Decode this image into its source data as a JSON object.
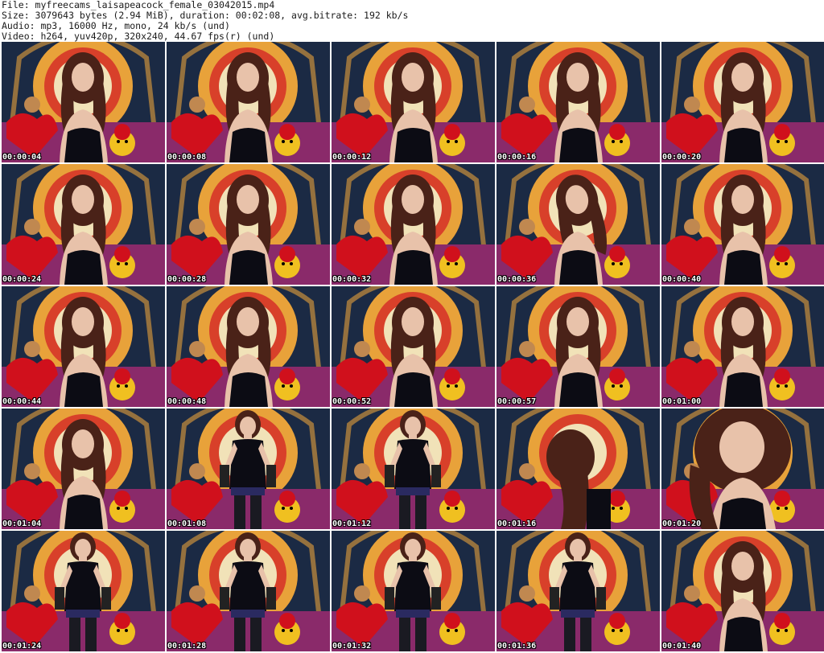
{
  "header": {
    "file": "File: myfreecams_laisapeacock_female_03042015.mp4",
    "size": "Size: 3079643 bytes (2.94 MiB), duration: 00:02:08, avg.bitrate: 192 kb/s",
    "audio": "Audio: mp3, 16000 Hz, mono, 24 kb/s (und)",
    "video": "Video: h264, yuv420p, 320x240, 44.67 fps(r) (und)"
  },
  "thumbnails": [
    {
      "time": "00:00:04",
      "pose": "seated"
    },
    {
      "time": "00:00:08",
      "pose": "seated"
    },
    {
      "time": "00:00:12",
      "pose": "seated"
    },
    {
      "time": "00:00:16",
      "pose": "seated"
    },
    {
      "time": "00:00:20",
      "pose": "seated"
    },
    {
      "time": "00:00:24",
      "pose": "seated"
    },
    {
      "time": "00:00:28",
      "pose": "seated"
    },
    {
      "time": "00:00:32",
      "pose": "seated"
    },
    {
      "time": "00:00:36",
      "pose": "tilted"
    },
    {
      "time": "00:00:40",
      "pose": "seated"
    },
    {
      "time": "00:00:44",
      "pose": "seated"
    },
    {
      "time": "00:00:48",
      "pose": "seated"
    },
    {
      "time": "00:00:52",
      "pose": "seated"
    },
    {
      "time": "00:00:57",
      "pose": "seated"
    },
    {
      "time": "00:01:00",
      "pose": "seated"
    },
    {
      "time": "00:01:04",
      "pose": "seated"
    },
    {
      "time": "00:01:08",
      "pose": "standing"
    },
    {
      "time": "00:01:12",
      "pose": "standing"
    },
    {
      "time": "00:01:16",
      "pose": "bent"
    },
    {
      "time": "00:01:20",
      "pose": "closeup"
    },
    {
      "time": "00:01:24",
      "pose": "standing"
    },
    {
      "time": "00:01:28",
      "pose": "standing"
    },
    {
      "time": "00:01:32",
      "pose": "standing"
    },
    {
      "time": "00:01:36",
      "pose": "standing"
    },
    {
      "time": "00:01:40",
      "pose": "seated"
    }
  ],
  "colors": {
    "backdrop": "#1b2a44",
    "tapestry_orange": "#e8a23a",
    "tapestry_red": "#d8402a",
    "tapestry_cream": "#f1e2b8",
    "cushion_red": "#d0101c",
    "couch_purple": "#8a2a6a",
    "toy_yellow": "#f0c020",
    "hair": "#4a2218",
    "skin": "#e8c2aa",
    "dress": "#0c0c14"
  }
}
